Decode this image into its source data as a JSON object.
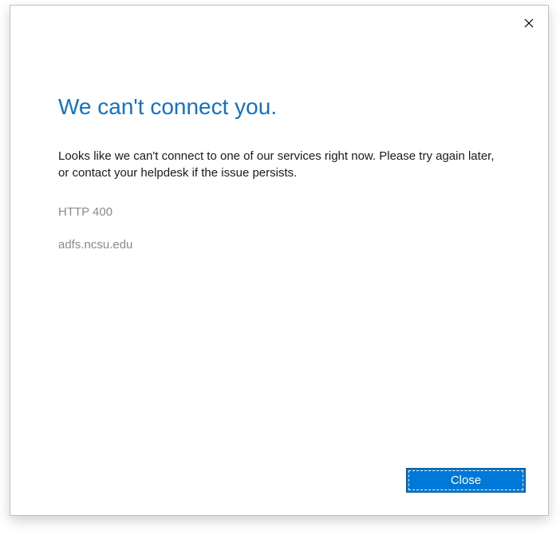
{
  "dialog": {
    "heading": "We can't connect you.",
    "message": "Looks like we can't connect to one of our services right now. Please try again later, or contact your helpdesk if the issue persists.",
    "error_code": "HTTP 400",
    "server": "adfs.ncsu.edu",
    "close_button_label": "Close"
  }
}
